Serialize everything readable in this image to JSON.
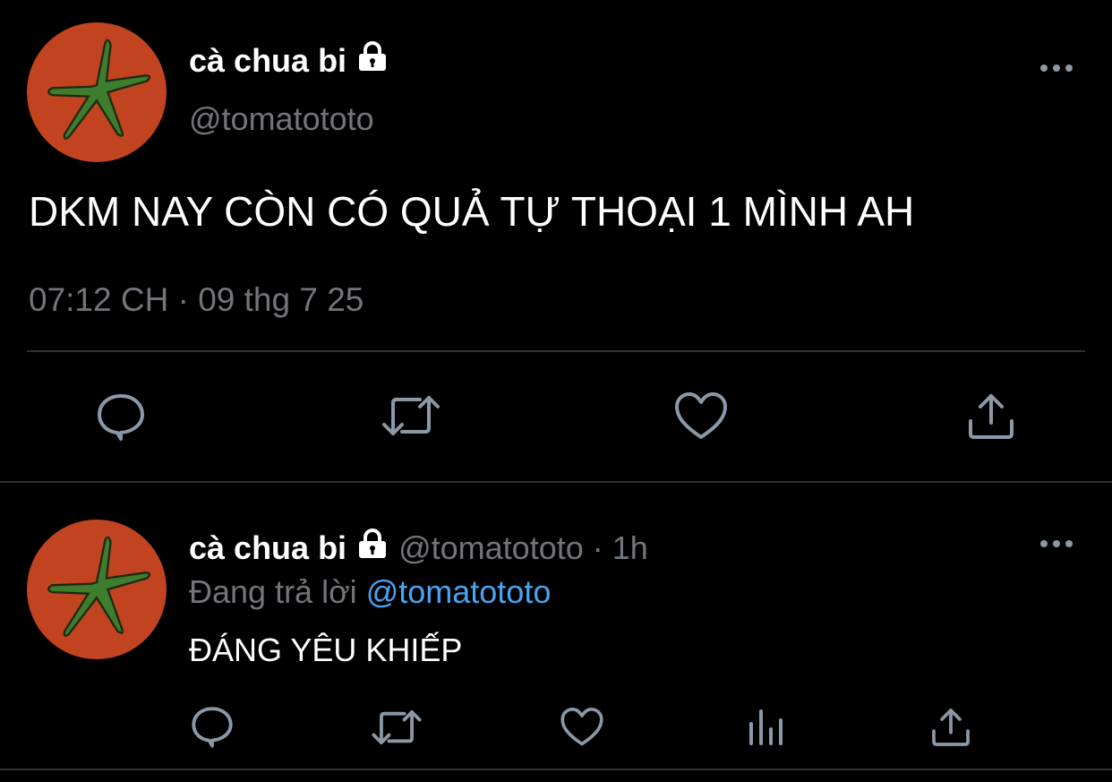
{
  "main_tweet": {
    "display_name": "cà chua bi",
    "handle": "@tomatototo",
    "text": "DKM NAY CÒN CÓ QUẢ TỰ THOẠI 1 MÌNH AH",
    "time": "07:12 CH",
    "separator": "·",
    "date": "09 thg 7 25",
    "more_label": "•••"
  },
  "reply_tweet": {
    "display_name": "cà chua bi",
    "handle": "@tomatototo",
    "separator": "·",
    "age": "1h",
    "replying_prefix": "Đang trả lời",
    "replying_to": "@tomatototo",
    "text": "ĐÁNG YÊU KHIẾP",
    "more_label": "•••"
  },
  "colors": {
    "background": "#000000",
    "text": "#ffffff",
    "muted": "#71767b",
    "icon": "#8b98a5",
    "mention": "#4aa3f0",
    "avatar": "#c1431f",
    "divider": "#2f3336"
  },
  "icons": [
    "lock-icon",
    "more-icon",
    "reply-icon",
    "retweet-icon",
    "like-icon",
    "views-icon",
    "share-icon"
  ]
}
